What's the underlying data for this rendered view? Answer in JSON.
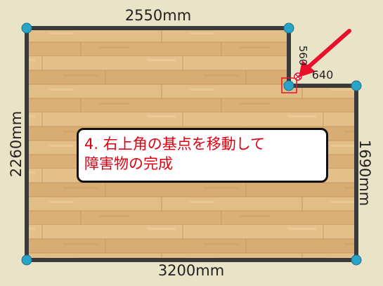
{
  "dimensions": {
    "top": "2550mm",
    "notch_vertical": "560",
    "notch_horizontal": "640",
    "left": "2260mm",
    "right": "1690mm",
    "bottom": "3200mm"
  },
  "instruction": {
    "line1": "4. 右上角の基点を移動して",
    "line2": "障害物の完成"
  },
  "colors": {
    "wall": "#3a3a3a",
    "node": "#2aa3c9",
    "arrow": "#e8102a",
    "highlight": "#e8102a",
    "instruction_text": "#e00010",
    "background": "#e9e4c7"
  }
}
